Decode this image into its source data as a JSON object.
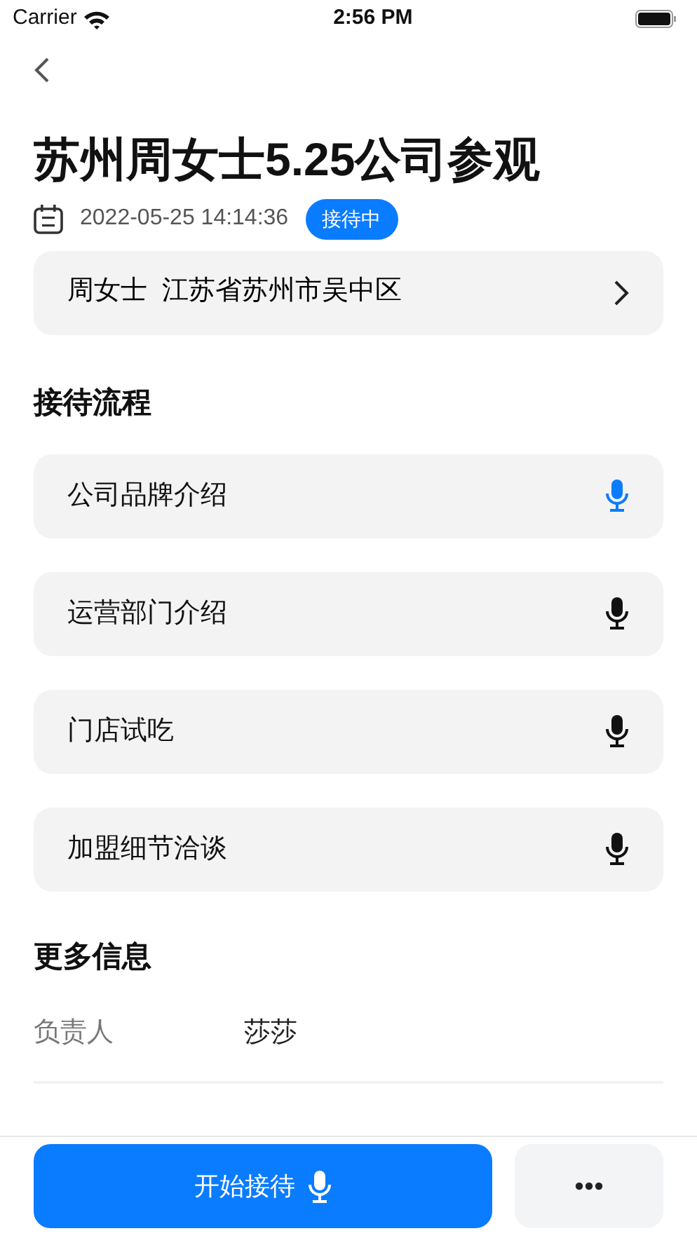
{
  "status_bar": {
    "carrier": "Carrier",
    "time": "2:56 PM"
  },
  "title": "苏州周女士5.25公司参观",
  "datetime": "2022-05-25 14:14:36",
  "status_badge": "接待中",
  "address": {
    "name": "周女士",
    "location": "江苏省苏州市吴中区"
  },
  "process": {
    "heading": "接待流程",
    "steps": [
      {
        "label": "公司品牌介绍",
        "active": true
      },
      {
        "label": "运营部门介绍",
        "active": false
      },
      {
        "label": "门店试吃",
        "active": false
      },
      {
        "label": "加盟细节洽谈",
        "active": false
      }
    ]
  },
  "more_info": {
    "heading": "更多信息",
    "rows": [
      {
        "label": "负责人",
        "value": "莎莎"
      }
    ]
  },
  "actions": {
    "primary": "开始接待"
  }
}
